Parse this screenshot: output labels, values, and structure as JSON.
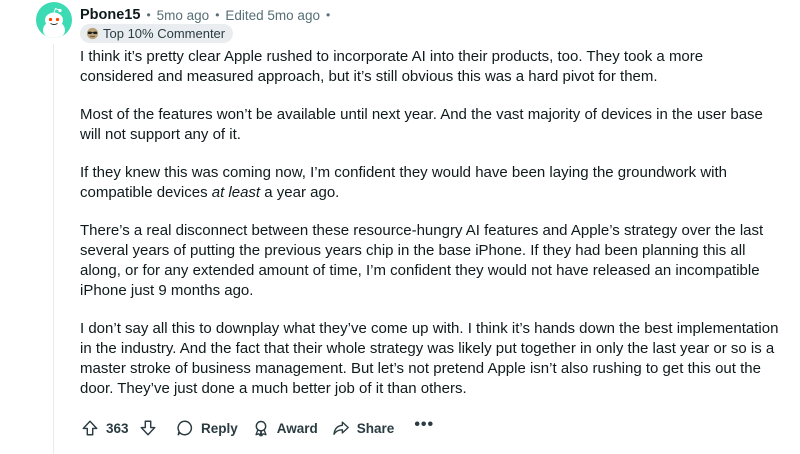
{
  "comment": {
    "username": "Pbone15",
    "age": "5mo ago",
    "edited": "Edited 5mo ago",
    "flair": {
      "icon": "sunglasses-emoji-icon",
      "label": "Top 10% Commenter"
    },
    "avatar": {
      "icon": "snoo-avatar-icon",
      "color": "#3ddbb4"
    },
    "paragraphs": [
      {
        "text": "I think it’s pretty clear Apple rushed to incorporate AI into their products, too. They took a more considered and measured approach, but it’s still obvious this was a hard pivot for them."
      },
      {
        "text": "Most of the features won’t be available until next year. And the vast majority of devices in the user base will not support any of it."
      },
      {
        "text_before": "If they knew this was coming now, I’m confident they would have been laying the groundwork with compatible devices ",
        "italic": "at least",
        "text_after": " a year ago."
      },
      {
        "text": "There’s a real disconnect between these resource-hungry AI features and Apple’s strategy over the last several years of putting the previous years chip in the base iPhone. If they had been planning this all along, or for any extended amount of time, I’m confident they would not have released an incompatible iPhone just 9 months ago."
      },
      {
        "text": "I don’t say all this to downplay what they’ve come up with. I think it’s hands down the best implementation in the industry. And the fact that their whole strategy was likely put together in only the last year or so is a master stroke of business management. But let’s not pretend Apple isn’t also rushing to get this out the door. They’ve just done a much better job of it than others."
      }
    ],
    "actions": {
      "score": "363",
      "reply_label": "Reply",
      "award_label": "Award",
      "share_label": "Share",
      "more_label": "•••"
    }
  }
}
